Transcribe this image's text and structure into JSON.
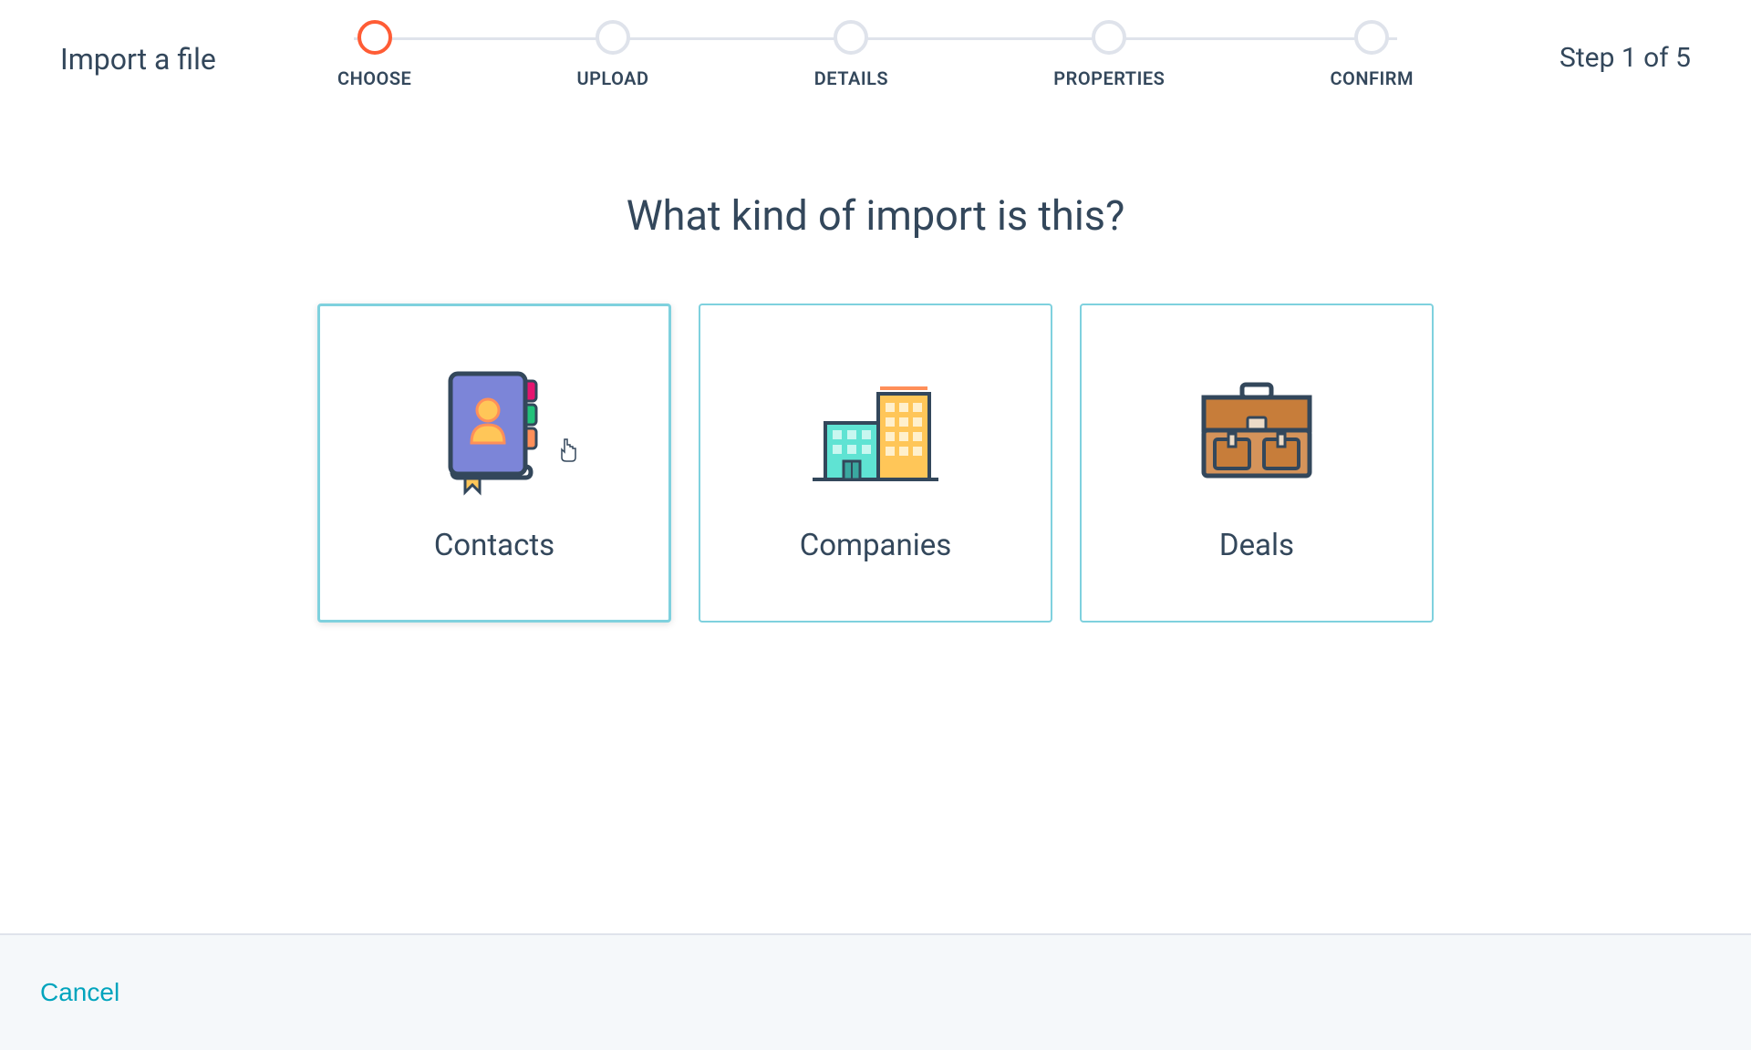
{
  "header": {
    "title": "Import a file",
    "step_text": "Step 1 of 5"
  },
  "stepper": {
    "steps": [
      {
        "label": "CHOOSE",
        "active": true
      },
      {
        "label": "UPLOAD",
        "active": false
      },
      {
        "label": "DETAILS",
        "active": false
      },
      {
        "label": "PROPERTIES",
        "active": false
      },
      {
        "label": "CONFIRM",
        "active": false
      }
    ]
  },
  "main": {
    "heading": "What kind of import is this?"
  },
  "cards": [
    {
      "label": "Contacts",
      "icon": "address-book-icon",
      "selected": true
    },
    {
      "label": "Companies",
      "icon": "buildings-icon",
      "selected": false
    },
    {
      "label": "Deals",
      "icon": "briefcase-icon",
      "selected": false
    }
  ],
  "footer": {
    "cancel_label": "Cancel"
  },
  "colors": {
    "accent_orange": "#ff5c35",
    "accent_teal": "#00a4bd",
    "border_teal": "#7fd1de",
    "text_primary": "#33475b",
    "border_grey": "#dfe3eb",
    "footer_bg": "#f5f8fa"
  }
}
